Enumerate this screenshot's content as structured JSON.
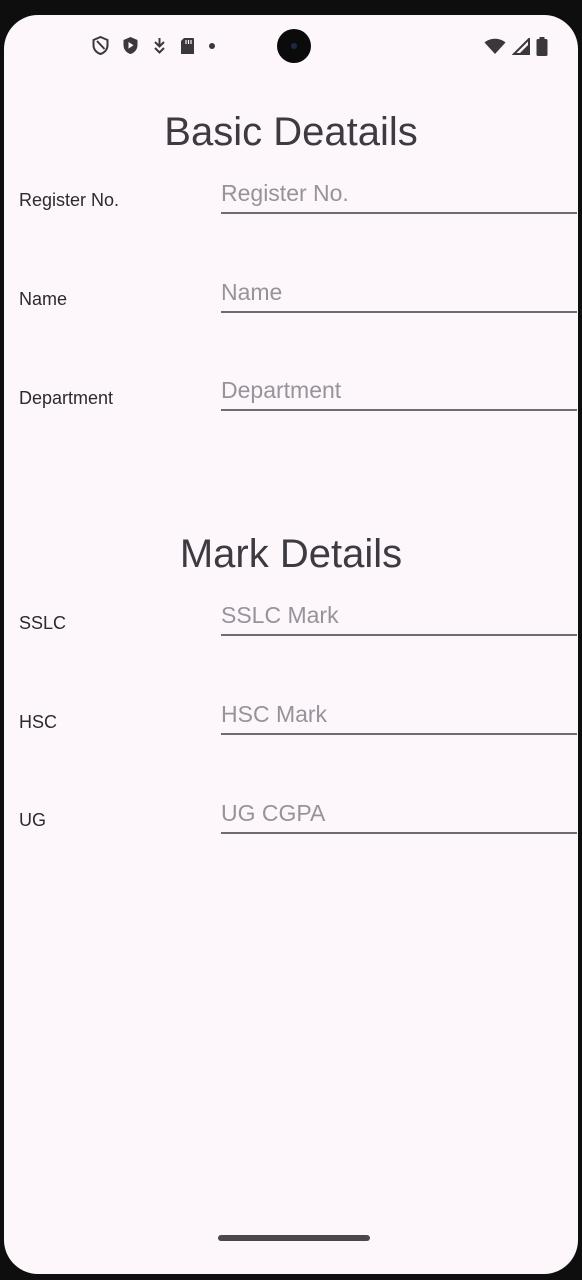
{
  "status_bar": {
    "left_icons": [
      "shield-outline-icon",
      "play-shield-icon",
      "download-icon",
      "sd-card-icon",
      "dot-icon"
    ],
    "right_icons": [
      "wifi-icon",
      "signal-icon",
      "battery-icon"
    ]
  },
  "basic_details": {
    "title": "Basic Deatails",
    "fields": [
      {
        "label": "Register No.",
        "placeholder": "Register No.",
        "value": ""
      },
      {
        "label": "Name",
        "placeholder": "Name",
        "value": ""
      },
      {
        "label": "Department",
        "placeholder": "Department",
        "value": ""
      }
    ]
  },
  "mark_details": {
    "title": "Mark Details",
    "fields": [
      {
        "label": "SSLC",
        "placeholder": "SSLC Mark",
        "value": ""
      },
      {
        "label": "HSC",
        "placeholder": "HSC Mark",
        "value": ""
      },
      {
        "label": "UG",
        "placeholder": "UG CGPA",
        "value": ""
      }
    ]
  },
  "colors": {
    "background": "#fdf7fc",
    "title": "#3d3a41",
    "label": "#2b2a2f",
    "placeholder": "#97939a",
    "underline": "#6f6b72"
  }
}
